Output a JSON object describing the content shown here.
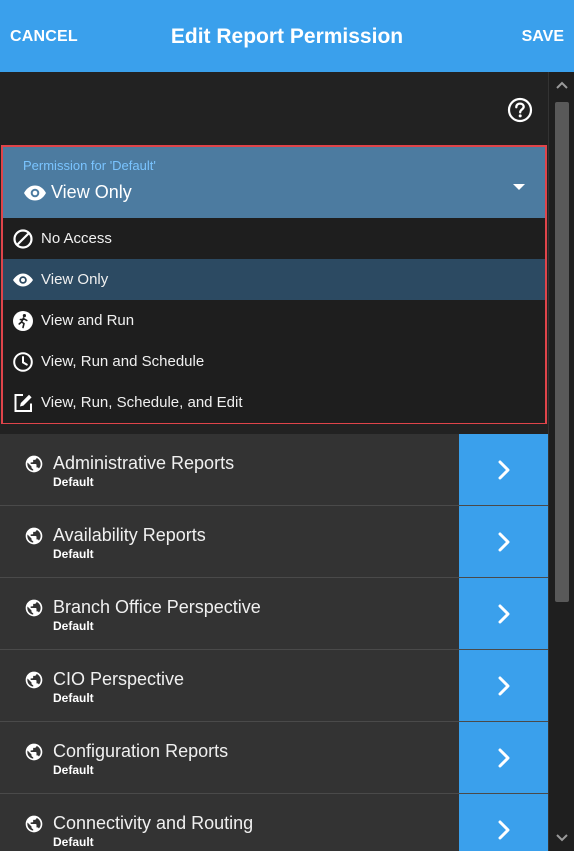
{
  "header": {
    "cancel_label": "CANCEL",
    "title": "Edit Report Permission",
    "save_label": "SAVE"
  },
  "permission": {
    "label": "Permission for 'Default'",
    "value": "View Only",
    "value_icon": "eye-icon",
    "options": [
      {
        "label": "No Access",
        "icon": "block-icon",
        "selected": false
      },
      {
        "label": "View Only",
        "icon": "eye-icon",
        "selected": true
      },
      {
        "label": "View and Run",
        "icon": "run-icon",
        "selected": false
      },
      {
        "label": "View, Run and Schedule",
        "icon": "clock-icon",
        "selected": false
      },
      {
        "label": "View, Run, Schedule, and Edit",
        "icon": "edit-icon",
        "selected": false
      }
    ]
  },
  "reports": [
    {
      "name": "Administrative Reports",
      "permission": "Default"
    },
    {
      "name": "Availability Reports",
      "permission": "Default"
    },
    {
      "name": "Branch Office Perspective",
      "permission": "Default"
    },
    {
      "name": "CIO Perspective",
      "permission": "Default"
    },
    {
      "name": "Configuration Reports",
      "permission": "Default"
    },
    {
      "name": "Connectivity and Routing",
      "permission": "Default"
    }
  ],
  "colors": {
    "accent": "#3aa0ec",
    "background": "#222222",
    "row_background": "#333333",
    "selected_option": "#2c4a62",
    "field_background": "#4c7ba0",
    "highlight_border": "#e0444a"
  }
}
